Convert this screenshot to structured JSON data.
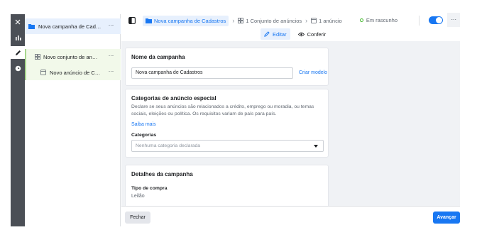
{
  "tree": {
    "campaign_label": "Nova campanha de Cadastros",
    "adset_label": "Novo conjunto de anúncios",
    "ad_label": "Novo anúncio de Cadastros",
    "more": "···"
  },
  "breadcrumb": {
    "campaign": "Nova campanha de Cadastros",
    "adset": "1 Conjunto de anúncios",
    "ad": "1 anúncio"
  },
  "status": {
    "label": "Em rascunho",
    "toggle_on": true
  },
  "tabs": {
    "edit": "Editar",
    "review": "Conferir"
  },
  "campaign_name_card": {
    "title": "Nome da campanha",
    "value": "Nova campanha de Cadastros",
    "template_link": "Criar modelo"
  },
  "special_categories_card": {
    "title": "Categorias de anúncio especial",
    "description": "Declare se seus anúncios são relacionados a crédito, emprego ou moradia, ou temas sociais, eleições ou política. Os requisitos variam de país para país.",
    "learn_more": "Saiba mais",
    "categories_label": "Categorias",
    "categories_placeholder": "Nenhuma categoria declarada"
  },
  "details_card": {
    "title": "Detalhes da campanha",
    "buy_type_label": "Tipo de compra",
    "buy_type_value": "Leilão"
  },
  "footer": {
    "close": "Fechar",
    "next": "Avançar"
  },
  "colors": {
    "accent": "#1877f2",
    "rail": "#4b4f56",
    "selected_bg": "#e7f0fd",
    "adset_bg": "#f2f9ea",
    "status_green": "#42b72a"
  }
}
